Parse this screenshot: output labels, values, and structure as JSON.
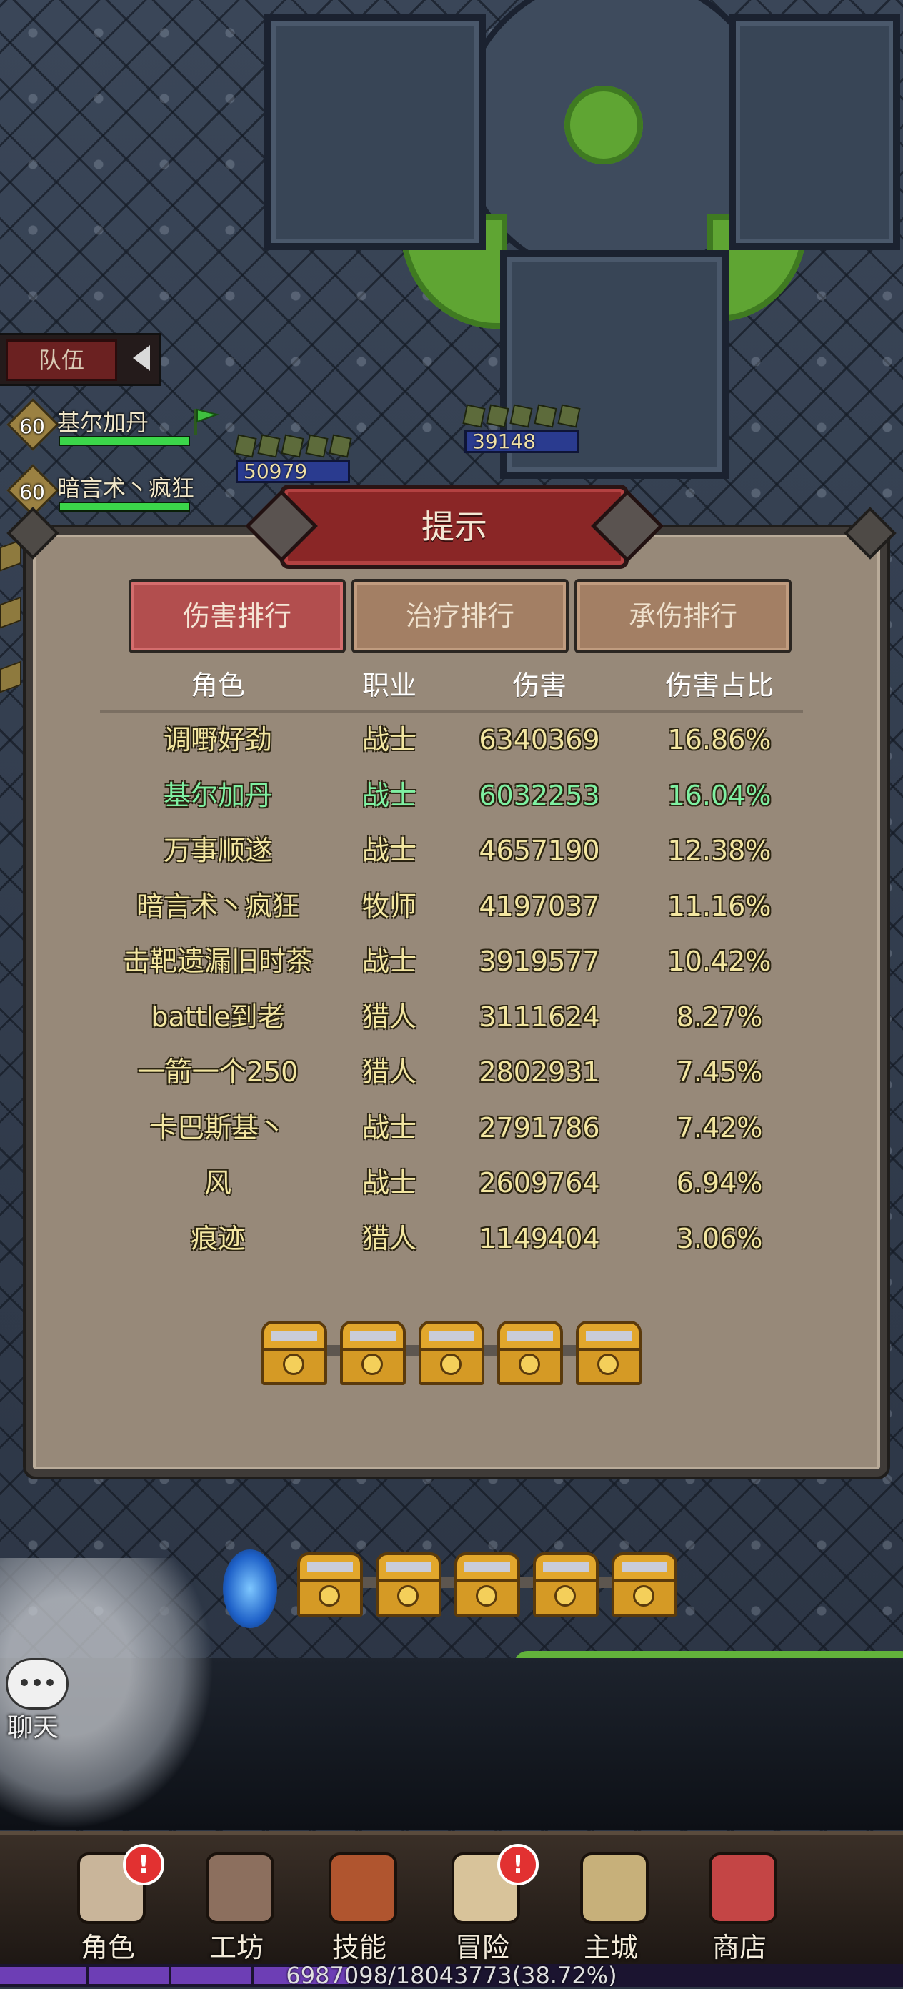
{
  "team_panel": {
    "tab_label": "队伍",
    "members": [
      {
        "level": "60",
        "name": "基尔加丹"
      },
      {
        "level": "60",
        "name": "暗言术丶疯狂"
      }
    ]
  },
  "enemies": [
    {
      "hp": "50979"
    },
    {
      "hp": "39148"
    }
  ],
  "dialog": {
    "title": "提示",
    "tabs": [
      {
        "label": "伤害排行",
        "active": true
      },
      {
        "label": "治疗排行",
        "active": false
      },
      {
        "label": "承伤排行",
        "active": false
      }
    ],
    "columns": [
      "角色",
      "职业",
      "伤害",
      "伤害占比"
    ],
    "rows": [
      {
        "name": "调嘢好劲",
        "class": "战士",
        "damage": "6340369",
        "share": "16.86%"
      },
      {
        "name": "基尔加丹",
        "class": "战士",
        "damage": "6032253",
        "share": "16.04%",
        "is_player": true
      },
      {
        "name": "万事顺遂",
        "class": "战士",
        "damage": "4657190",
        "share": "12.38%"
      },
      {
        "name": "暗言术丶疯狂",
        "class": "牧师",
        "damage": "4197037",
        "share": "11.16%"
      },
      {
        "name": "击靶遗漏旧时茶",
        "class": "战士",
        "damage": "3919577",
        "share": "10.42%"
      },
      {
        "name": "battle到老",
        "class": "猎人",
        "damage": "3111624",
        "share": "8.27%"
      },
      {
        "name": "一箭一个250",
        "class": "猎人",
        "damage": "2802931",
        "share": "7.45%"
      },
      {
        "name": "卡巴斯基丶",
        "class": "战士",
        "damage": "2791786",
        "share": "7.42%"
      },
      {
        "name": "风",
        "class": "战士",
        "damage": "2609764",
        "share": "6.94%"
      },
      {
        "name": "痕迹",
        "class": "猎人",
        "damage": "1149404",
        "share": "3.06%"
      }
    ],
    "chest_count": 5
  },
  "chat": {
    "label": "聊天"
  },
  "nav": [
    {
      "label": "角色",
      "badge": "!",
      "icon": "character-icon",
      "color": "#c9b59a"
    },
    {
      "label": "工坊",
      "badge": "",
      "icon": "anvil-icon",
      "color": "#8c6f5e"
    },
    {
      "label": "技能",
      "badge": "",
      "icon": "spellbook-icon",
      "color": "#b0552f"
    },
    {
      "label": "冒险",
      "badge": "!",
      "icon": "scroll-icon",
      "color": "#d8c39a"
    },
    {
      "label": "主城",
      "badge": "",
      "icon": "castle-icon",
      "color": "#c7b07a"
    },
    {
      "label": "商店",
      "badge": "",
      "icon": "shop-icon",
      "color": "#c44545"
    }
  ],
  "exp_bar": {
    "text": "6987098/18043773(38.72%)",
    "fraction": 0.3872
  },
  "colors": {
    "accent_red": "#b24e4e",
    "player_green": "#7ff0a2",
    "value_yellow": "#f3e6a1"
  }
}
